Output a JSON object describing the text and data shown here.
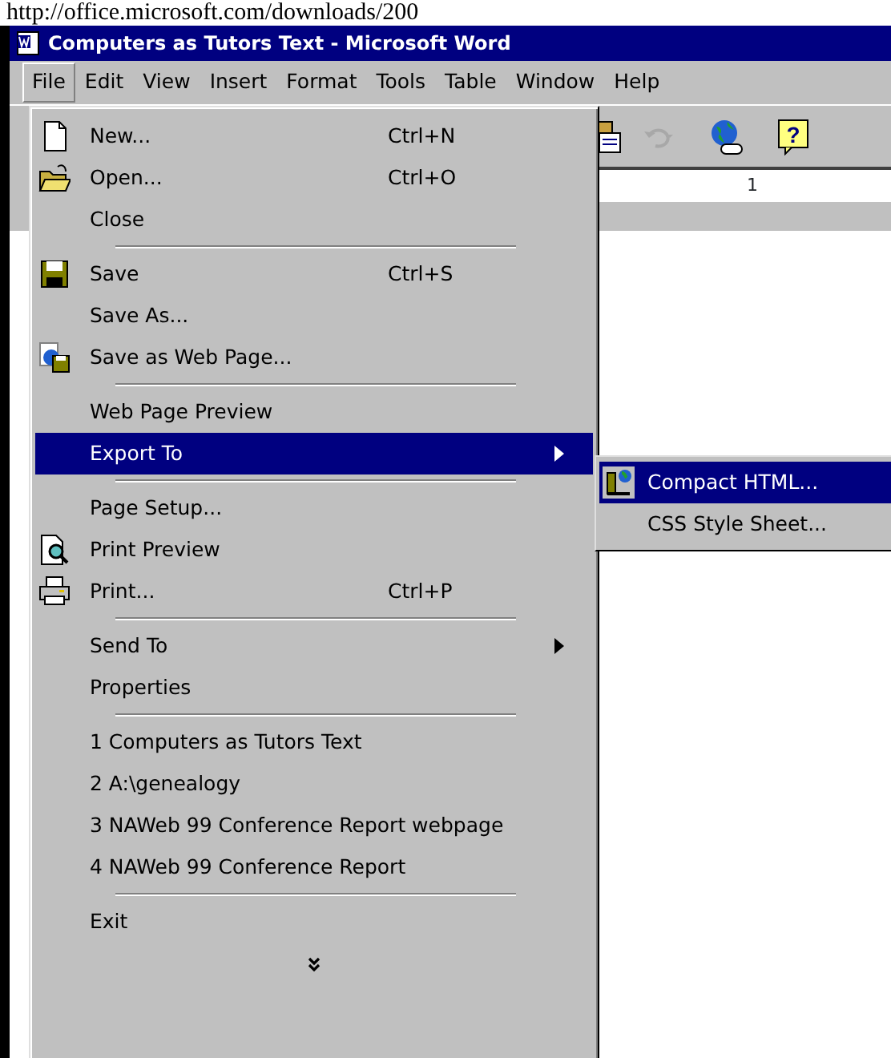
{
  "url_text": "http://office.microsoft.com/downloads/200",
  "window": {
    "title": "Computers as Tutors Text - Microsoft Word"
  },
  "menubar": [
    {
      "label": "File",
      "selected": true
    },
    {
      "label": "Edit",
      "selected": false
    },
    {
      "label": "View",
      "selected": false
    },
    {
      "label": "Insert",
      "selected": false
    },
    {
      "label": "Format",
      "selected": false
    },
    {
      "label": "Tools",
      "selected": false
    },
    {
      "label": "Table",
      "selected": false
    },
    {
      "label": "Window",
      "selected": false
    },
    {
      "label": "Help",
      "selected": false
    }
  ],
  "toolbar": [
    {
      "disabled": false
    },
    {
      "disabled": true
    },
    {
      "disabled": false
    },
    {
      "disabled": false,
      "label": "?"
    }
  ],
  "ruler": {
    "label": "1"
  },
  "file_menu": [
    {
      "kind": "item",
      "label": "New...",
      "shortcut": "Ctrl+N",
      "has_icon": true,
      "selected": false
    },
    {
      "kind": "item",
      "label": "Open...",
      "shortcut": "Ctrl+O",
      "has_icon": true,
      "selected": false
    },
    {
      "kind": "item",
      "label": "Close",
      "selected": false
    },
    {
      "kind": "separator"
    },
    {
      "kind": "item",
      "label": "Save",
      "shortcut": "Ctrl+S",
      "has_icon": true,
      "selected": false
    },
    {
      "kind": "item",
      "label": "Save As...",
      "selected": false
    },
    {
      "kind": "item",
      "label": "Save as Web Page...",
      "has_icon": true,
      "selected": false
    },
    {
      "kind": "separator"
    },
    {
      "kind": "item",
      "label": "Web Page Preview",
      "selected": false
    },
    {
      "kind": "item",
      "label": "Export To",
      "submenu": true,
      "selected": true
    },
    {
      "kind": "separator"
    },
    {
      "kind": "item",
      "label": "Page Setup...",
      "selected": false
    },
    {
      "kind": "item",
      "label": "Print Preview",
      "has_icon": true,
      "selected": false
    },
    {
      "kind": "item",
      "label": "Print...",
      "shortcut": "Ctrl+P",
      "has_icon": true,
      "selected": false
    },
    {
      "kind": "separator"
    },
    {
      "kind": "item",
      "label": "Send To",
      "submenu": true,
      "selected": false
    },
    {
      "kind": "item",
      "label": "Properties",
      "selected": false
    },
    {
      "kind": "separator"
    },
    {
      "kind": "item",
      "label": "1 Computers as Tutors Text",
      "selected": false
    },
    {
      "kind": "item",
      "label": "2 A:\\genealogy",
      "selected": false
    },
    {
      "kind": "item",
      "label": "3 NAWeb 99 Conference Report webpage",
      "selected": false
    },
    {
      "kind": "item",
      "label": "4 NAWeb 99 Conference Report",
      "selected": false
    },
    {
      "kind": "separator"
    },
    {
      "kind": "item",
      "label": "Exit",
      "selected": false
    },
    {
      "kind": "expand"
    }
  ],
  "export_submenu": [
    {
      "label": "Compact HTML...",
      "has_icon": true,
      "selected": true
    },
    {
      "label": "CSS Style Sheet...",
      "selected": false
    }
  ]
}
